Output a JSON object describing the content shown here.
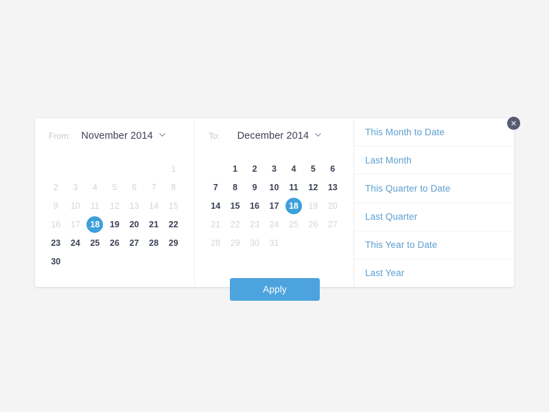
{
  "panel": {
    "close_icon": "close-icon"
  },
  "from_calendar": {
    "label": "From:",
    "month": "November 2014",
    "chevron_icon": "chevron-down-icon",
    "weeks": [
      [
        {
          "d": "",
          "state": "blank"
        },
        {
          "d": "",
          "state": "blank"
        },
        {
          "d": "",
          "state": "blank"
        },
        {
          "d": "",
          "state": "blank"
        },
        {
          "d": "",
          "state": "blank"
        },
        {
          "d": "",
          "state": "blank"
        },
        {
          "d": "1",
          "state": "muted"
        }
      ],
      [
        {
          "d": "2",
          "state": "muted"
        },
        {
          "d": "3",
          "state": "muted"
        },
        {
          "d": "4",
          "state": "muted"
        },
        {
          "d": "5",
          "state": "muted"
        },
        {
          "d": "6",
          "state": "muted"
        },
        {
          "d": "7",
          "state": "muted"
        },
        {
          "d": "8",
          "state": "muted"
        }
      ],
      [
        {
          "d": "9",
          "state": "muted"
        },
        {
          "d": "10",
          "state": "muted"
        },
        {
          "d": "11",
          "state": "muted"
        },
        {
          "d": "12",
          "state": "muted"
        },
        {
          "d": "13",
          "state": "muted"
        },
        {
          "d": "14",
          "state": "muted"
        },
        {
          "d": "15",
          "state": "muted"
        }
      ],
      [
        {
          "d": "16",
          "state": "muted"
        },
        {
          "d": "17",
          "state": "muted"
        },
        {
          "d": "18",
          "state": "selected"
        },
        {
          "d": "19",
          "state": "active"
        },
        {
          "d": "20",
          "state": "active"
        },
        {
          "d": "21",
          "state": "active"
        },
        {
          "d": "22",
          "state": "active"
        }
      ],
      [
        {
          "d": "23",
          "state": "active"
        },
        {
          "d": "24",
          "state": "active"
        },
        {
          "d": "25",
          "state": "active"
        },
        {
          "d": "26",
          "state": "active"
        },
        {
          "d": "27",
          "state": "active"
        },
        {
          "d": "28",
          "state": "active"
        },
        {
          "d": "29",
          "state": "active"
        }
      ],
      [
        {
          "d": "30",
          "state": "active"
        },
        {
          "d": "",
          "state": "blank"
        },
        {
          "d": "",
          "state": "blank"
        },
        {
          "d": "",
          "state": "blank"
        },
        {
          "d": "",
          "state": "blank"
        },
        {
          "d": "",
          "state": "blank"
        },
        {
          "d": "",
          "state": "blank"
        }
      ]
    ]
  },
  "to_calendar": {
    "label": "To:",
    "month": "December 2014",
    "chevron_icon": "chevron-down-icon",
    "weeks": [
      [
        {
          "d": "",
          "state": "blank"
        },
        {
          "d": "1",
          "state": "active"
        },
        {
          "d": "2",
          "state": "active"
        },
        {
          "d": "3",
          "state": "active"
        },
        {
          "d": "4",
          "state": "active"
        },
        {
          "d": "5",
          "state": "active"
        },
        {
          "d": "6",
          "state": "active"
        }
      ],
      [
        {
          "d": "7",
          "state": "active"
        },
        {
          "d": "8",
          "state": "active"
        },
        {
          "d": "9",
          "state": "active"
        },
        {
          "d": "10",
          "state": "active"
        },
        {
          "d": "11",
          "state": "active"
        },
        {
          "d": "12",
          "state": "active"
        },
        {
          "d": "13",
          "state": "active"
        }
      ],
      [
        {
          "d": "14",
          "state": "active"
        },
        {
          "d": "15",
          "state": "active"
        },
        {
          "d": "16",
          "state": "active"
        },
        {
          "d": "17",
          "state": "active"
        },
        {
          "d": "18",
          "state": "selected"
        },
        {
          "d": "19",
          "state": "muted"
        },
        {
          "d": "20",
          "state": "muted"
        }
      ],
      [
        {
          "d": "21",
          "state": "muted"
        },
        {
          "d": "22",
          "state": "muted"
        },
        {
          "d": "23",
          "state": "muted"
        },
        {
          "d": "24",
          "state": "muted"
        },
        {
          "d": "25",
          "state": "muted"
        },
        {
          "d": "26",
          "state": "muted"
        },
        {
          "d": "27",
          "state": "muted"
        }
      ],
      [
        {
          "d": "28",
          "state": "muted"
        },
        {
          "d": "29",
          "state": "muted"
        },
        {
          "d": "30",
          "state": "muted"
        },
        {
          "d": "31",
          "state": "muted"
        },
        {
          "d": "",
          "state": "blank"
        },
        {
          "d": "",
          "state": "blank"
        },
        {
          "d": "",
          "state": "blank"
        }
      ]
    ]
  },
  "presets": [
    {
      "label": "This Month to Date"
    },
    {
      "label": "Last Month"
    },
    {
      "label": "This Quarter to Date"
    },
    {
      "label": "Last Quarter"
    },
    {
      "label": "This Year to Date"
    },
    {
      "label": "Last Year"
    }
  ],
  "apply_button": {
    "label": "Apply"
  },
  "colors": {
    "accent": "#3d9fdb",
    "apply": "#4ca3dd",
    "preset_text": "#5b9ed0",
    "day_active": "#3b4155",
    "day_muted": "#d3d5d8",
    "close_bg": "#555b72",
    "page_bg": "#f4f4f5"
  }
}
